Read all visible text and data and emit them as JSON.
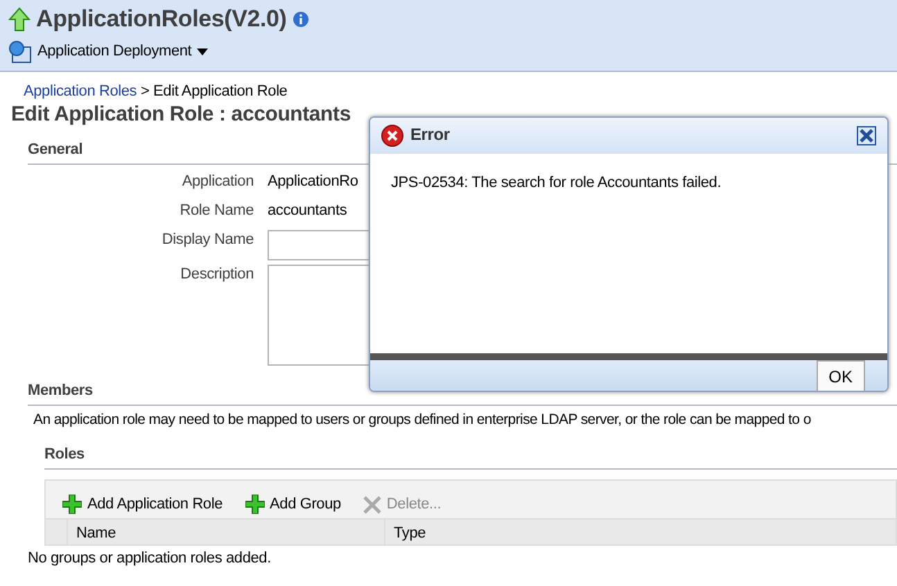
{
  "header": {
    "title": "ApplicationRoles(V2.0)",
    "menu": "Application Deployment"
  },
  "breadcrumb": {
    "link": "Application Roles",
    "separator": ">",
    "current": "Edit Application Role"
  },
  "page_title": "Edit Application Role : accountants",
  "general": {
    "heading": "General",
    "fields": [
      {
        "kind": "text",
        "label": "Application",
        "value": "ApplicationRo"
      },
      {
        "kind": "text",
        "label": "Role Name",
        "value": "accountants"
      },
      {
        "kind": "input",
        "label": "Display Name"
      },
      {
        "kind": "textarea",
        "label": "Description"
      }
    ]
  },
  "members": {
    "heading": "Members",
    "description": "An application role may need to be mapped to users or groups defined in enterprise LDAP server, or the role can be mapped to o"
  },
  "roles": {
    "heading": "Roles",
    "toolbar": [
      {
        "kind": "add",
        "label": "Add Application Role",
        "disabled": false
      },
      {
        "kind": "add",
        "label": "Add Group",
        "disabled": false
      },
      {
        "kind": "delete",
        "label": "Delete...",
        "disabled": true
      }
    ],
    "columns": [
      "Name",
      "Type"
    ],
    "empty_text": "No groups or application roles added."
  },
  "dialog": {
    "title": "Error",
    "message": "JPS-02534: The search for role Accountants failed.",
    "button": "OK"
  }
}
